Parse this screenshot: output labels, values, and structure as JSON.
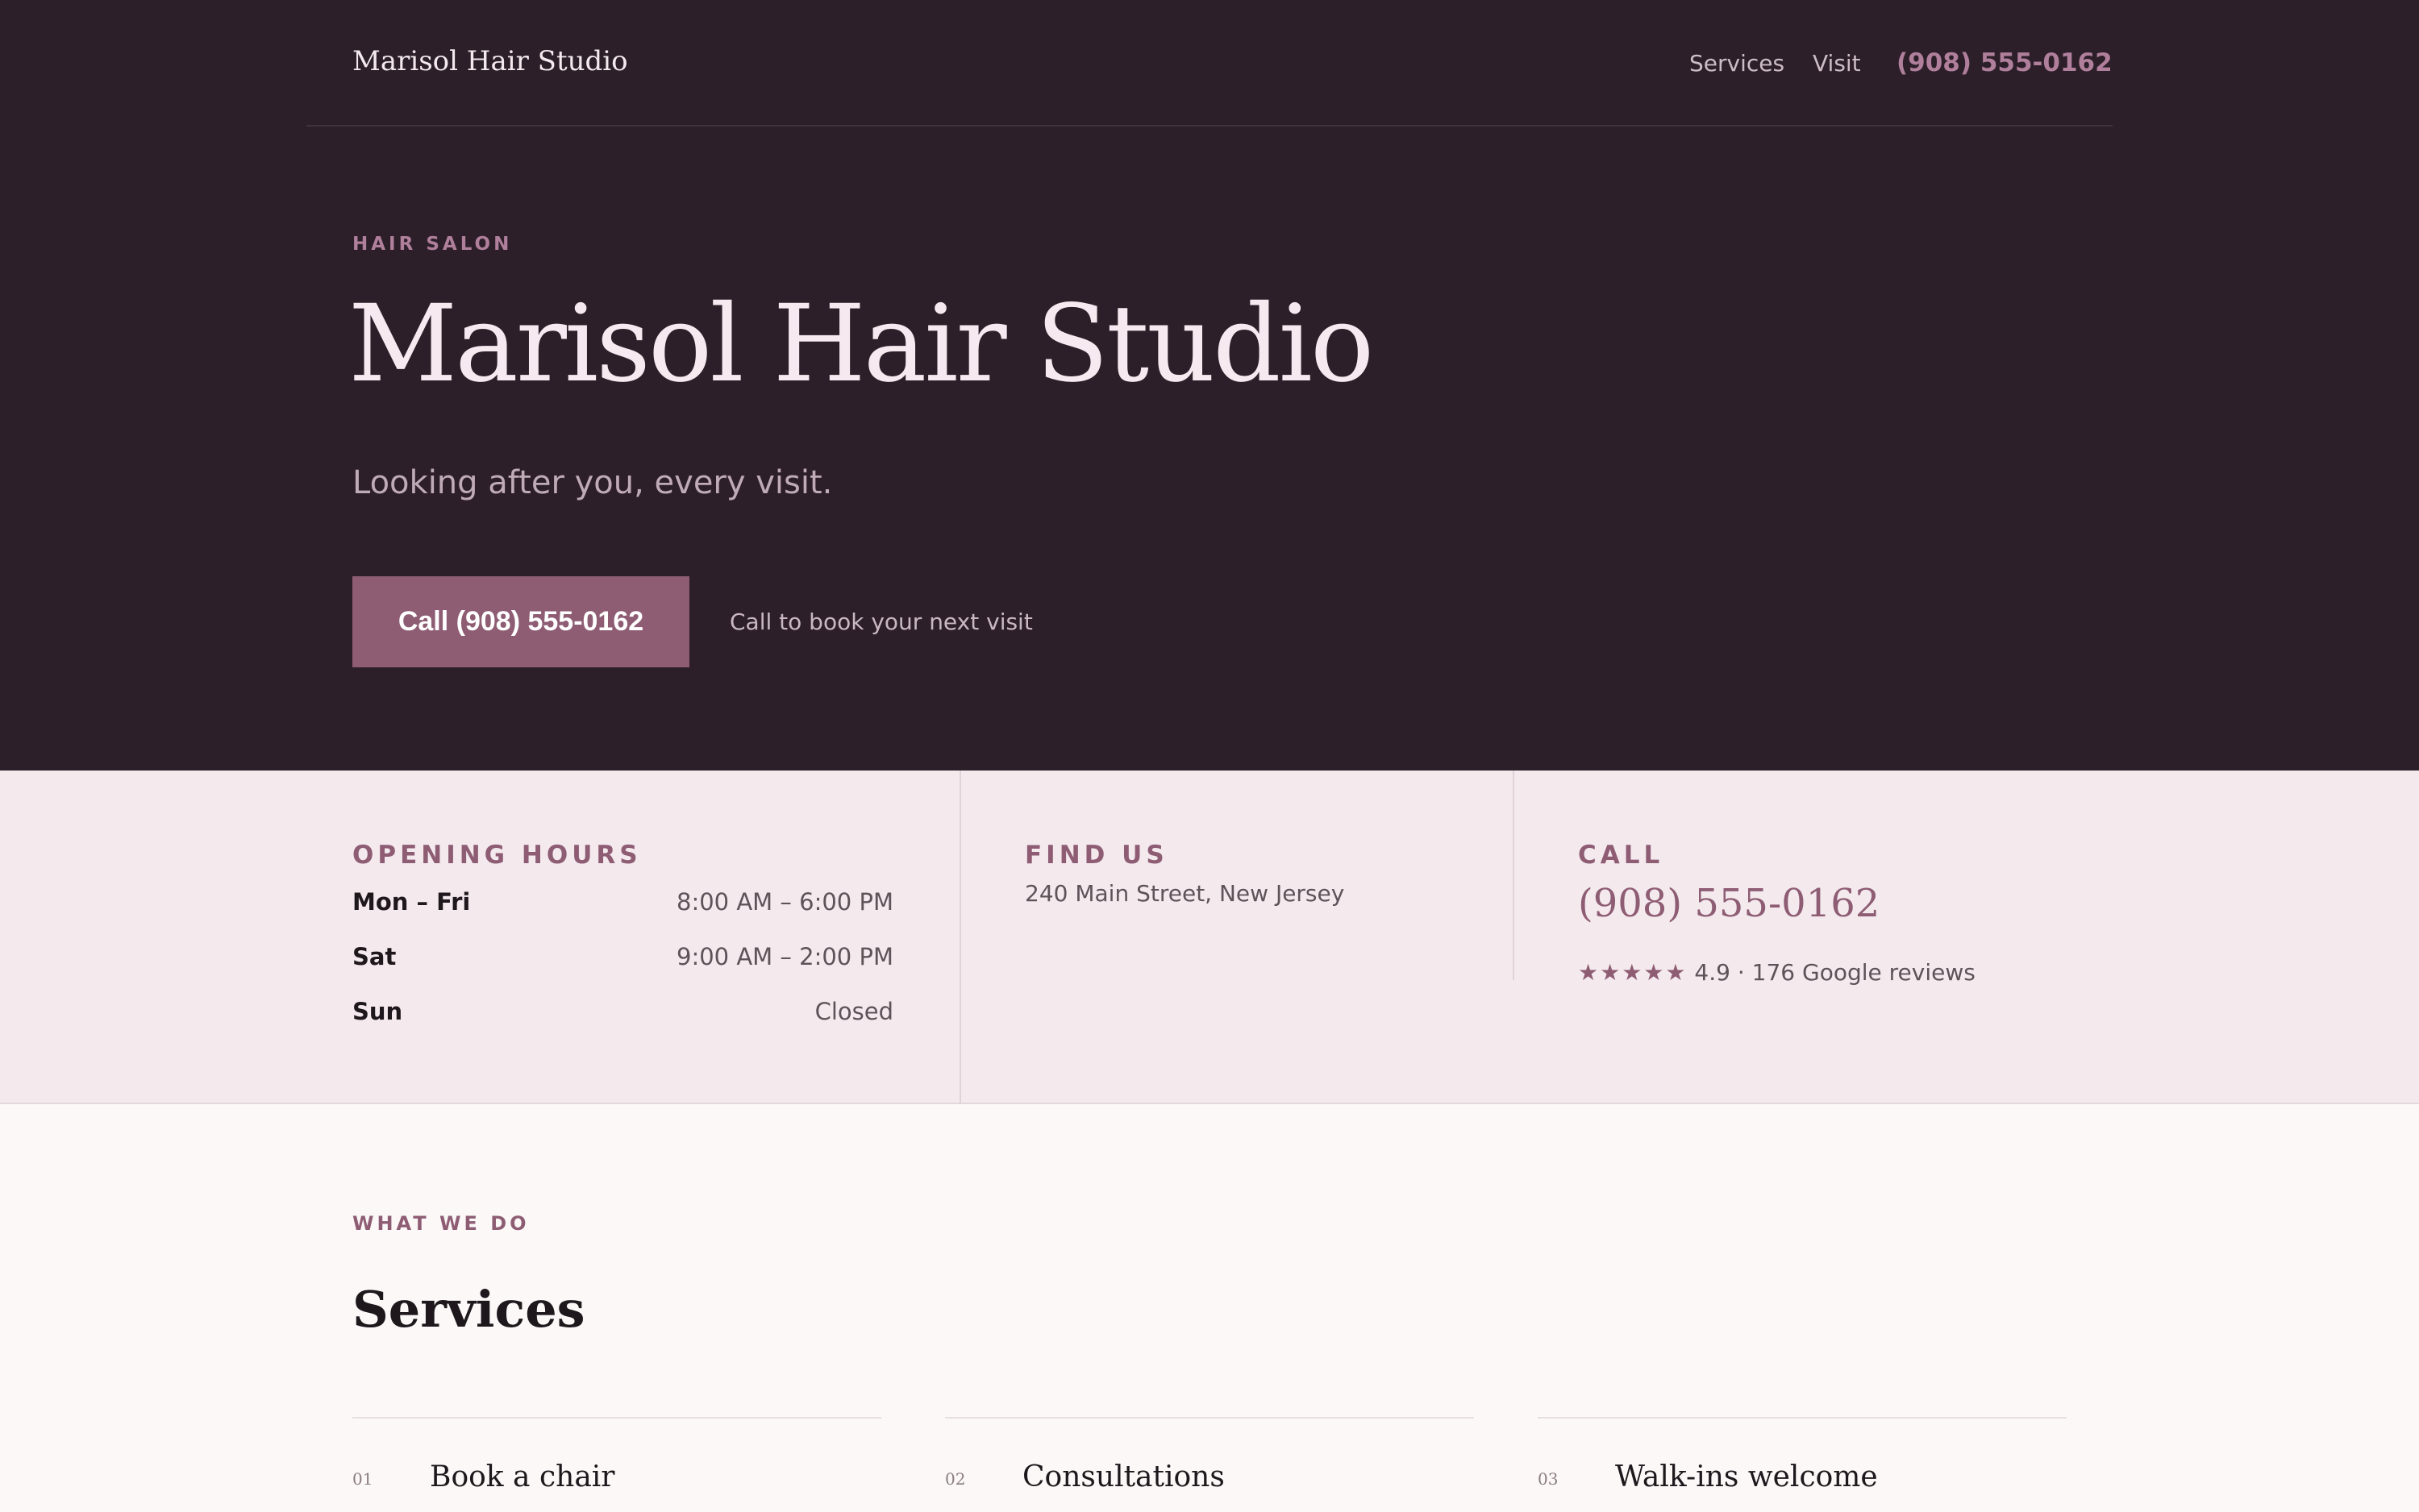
{
  "nav": {
    "brand": "Marisol Hair Studio",
    "links": [
      "Services",
      "Visit"
    ],
    "phone": "(908) 555-0162"
  },
  "hero": {
    "eyebrow": "HAIR SALON",
    "title": "Marisol Hair Studio",
    "tagline": "Looking after you, every visit.",
    "cta_label": "Call (908) 555-0162",
    "cta_note": "Call to book your next visit"
  },
  "info": {
    "hours_heading": "OPENING HOURS",
    "hours": [
      {
        "day": "Mon – Fri",
        "time": "8:00 AM – 6:00 PM"
      },
      {
        "day": "Sat",
        "time": "9:00 AM – 2:00 PM"
      },
      {
        "day": "Sun",
        "time": "Closed"
      }
    ],
    "find_heading": "FIND US",
    "address": "240 Main Street, New Jersey",
    "call_heading": "CALL",
    "phone": "(908) 555-0162",
    "stars": "★★★★★",
    "rating_text": "4.9 · 176 Google reviews"
  },
  "services": {
    "eyebrow": "WHAT WE DO",
    "title": "Services",
    "items": [
      {
        "num": "01",
        "name": "Book a chair"
      },
      {
        "num": "02",
        "name": "Consultations"
      },
      {
        "num": "03",
        "name": "Walk-ins welcome"
      }
    ]
  },
  "colors": {
    "hero_bg": "#2c1f29",
    "accent": "#8e5d74",
    "info_bg": "#f4eaee",
    "page_bg": "#fbf8f7"
  }
}
